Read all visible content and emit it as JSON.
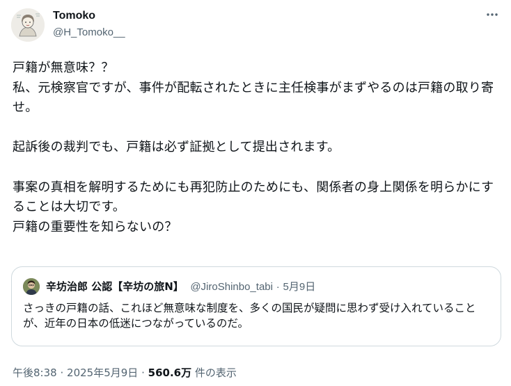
{
  "author": {
    "name": "Tomoko",
    "handle": "@H_Tomoko__"
  },
  "tweet": {
    "text": "戸籍が無意味？？\n私、元検察官ですが、事件が配転されたときに主任検事がまずやるのは戸籍の取り寄せ。\n\n起訴後の裁判でも、戸籍は必ず証拠として提出されます。\n\n事案の真相を解明するためにも再犯防止のためにも、関係者の身上関係を明らかにすることは大切です。\n戸籍の重要性を知らないの？"
  },
  "quote": {
    "name": "辛坊治郎 公認【辛坊の旅N】",
    "handle": "@JiroShinbo_tabi",
    "separator": "·",
    "date": "5月9日",
    "text": "さっきの戸籍の話、これほど無意味な制度を、多くの国民が疑問に思わず受け入れていることが、近年の日本の低迷につながっているのだ。"
  },
  "meta": {
    "time": "午後8:38",
    "sep1": "·",
    "date": "2025年5月9日",
    "sep2": "·",
    "views_count": "560.6万",
    "views_label": "件の表示"
  },
  "icons": {
    "more": "more-horizontal-icon"
  }
}
